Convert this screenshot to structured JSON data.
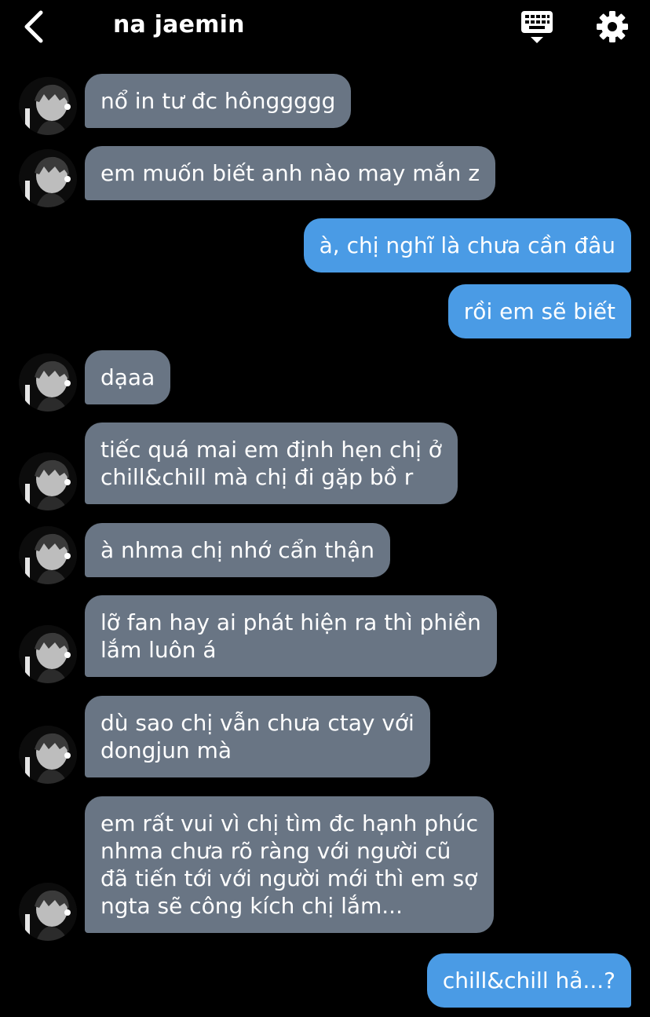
{
  "header": {
    "contact_name": "na jaemin",
    "back_icon": "chevron-left-icon",
    "keyboard_icon": "keyboard-icon",
    "settings_icon": "gear-icon"
  },
  "colors": {
    "background": "#000000",
    "incoming_bubble": "#697584",
    "outgoing_bubble": "#4a9be5",
    "text": "#ffffff"
  },
  "messages": [
    {
      "sender": "contact",
      "text": "nổ in tư đc hônggggg"
    },
    {
      "sender": "contact",
      "text": "em muốn biết anh nào may mắn z"
    },
    {
      "sender": "me",
      "text": "à, chị nghĩ là chưa cần đâu"
    },
    {
      "sender": "me",
      "text": "rồi em sẽ biết"
    },
    {
      "sender": "contact",
      "text": "dạaa"
    },
    {
      "sender": "contact",
      "text": "tiếc quá mai em định hẹn chị ở\nchill&chill mà chị đi gặp bồ r"
    },
    {
      "sender": "contact",
      "text": "à nhma chị nhớ cẩn thận"
    },
    {
      "sender": "contact",
      "text": "lỡ fan hay ai phát hiện ra thì phiền\nlắm luôn á"
    },
    {
      "sender": "contact",
      "text": "dù sao chị vẫn chưa ctay với\ndongjun mà"
    },
    {
      "sender": "contact",
      "text": "em rất vui vì chị tìm đc hạnh phúc\nnhma chưa rõ ràng với người cũ\nđã tiến tới với người mới thì em sợ\nngta sẽ công kích chị lắm..."
    },
    {
      "sender": "me",
      "text": "chill&chill hả...?"
    }
  ]
}
